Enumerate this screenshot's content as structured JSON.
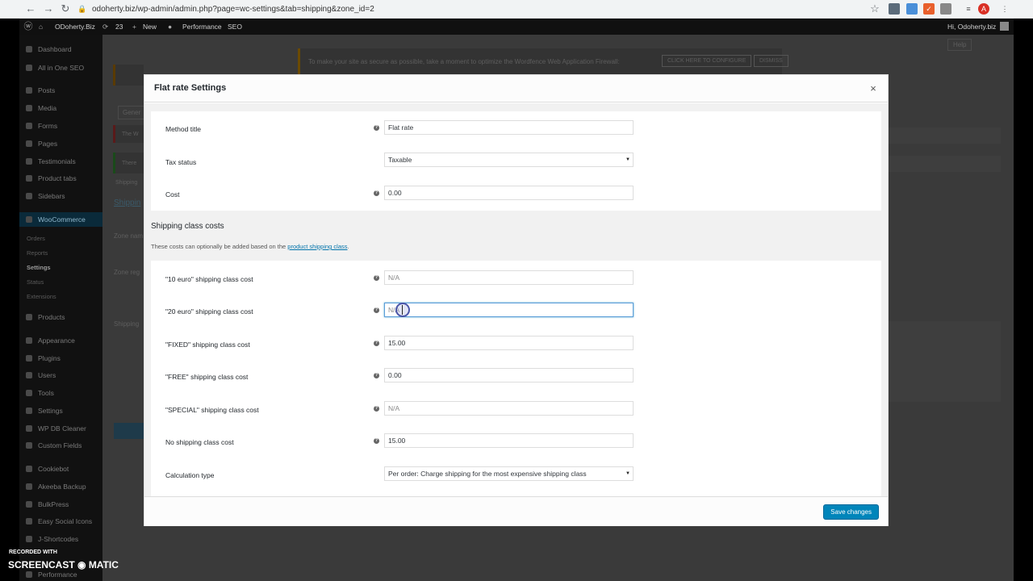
{
  "browser": {
    "url": "odoherty.biz/wp-admin/admin.php?page=wc-settings&tab=shipping&zone_id=2",
    "profile_initial": "A"
  },
  "adminbar": {
    "site_name": "ODoherty.Biz",
    "updates_count": "23",
    "new_label": "New",
    "performance_label": "Performance",
    "seo_label": "SEO",
    "greeting": "Hi, Odoherty.biz"
  },
  "sidebar": {
    "items": [
      {
        "label": "Dashboard"
      },
      {
        "label": "All in One SEO"
      },
      {
        "label": "Posts"
      },
      {
        "label": "Media"
      },
      {
        "label": "Forms"
      },
      {
        "label": "Pages"
      },
      {
        "label": "Testimonials"
      },
      {
        "label": "Product tabs"
      },
      {
        "label": "Sidebars"
      },
      {
        "label": "WooCommerce"
      },
      {
        "label": "Orders"
      },
      {
        "label": "Reports"
      },
      {
        "label": "Settings"
      },
      {
        "label": "Status"
      },
      {
        "label": "Extensions"
      },
      {
        "label": "Products"
      },
      {
        "label": "Appearance"
      },
      {
        "label": "Plugins"
      },
      {
        "label": "Users"
      },
      {
        "label": "Tools"
      },
      {
        "label": "Settings"
      },
      {
        "label": "WP DB Cleaner"
      },
      {
        "label": "Custom Fields"
      },
      {
        "label": "Cookiebot"
      },
      {
        "label": "Akeeba Backup"
      },
      {
        "label": "BulkPress"
      },
      {
        "label": "Easy Social Icons"
      },
      {
        "label": "J-Shortcodes"
      },
      {
        "label": "Performance"
      }
    ]
  },
  "background": {
    "notice_text": "To make your site as secure as possible, take a moment to optimize the Wordfence Web Application Firewall:",
    "notice_btn1": "CLICK HERE TO CONFIGURE",
    "notice_btn2": "DISMISS",
    "help_tab": "Help",
    "gen_tab": "Gener",
    "zone_name_label": "Zone nam",
    "zone_region_label": "Zone reg",
    "shipping_label": "Shipping",
    "shipping_link": "Shippin",
    "small_1": "The W",
    "small_2": "There",
    "small_3": "Shipping"
  },
  "modal": {
    "title": "Flat rate Settings",
    "close_glyph": "×",
    "help_glyph": "?",
    "fields": {
      "method_title": {
        "label": "Method title",
        "value": "Flat rate"
      },
      "tax_status": {
        "label": "Tax status",
        "value": "Taxable"
      },
      "cost": {
        "label": "Cost",
        "value": "0.00"
      }
    },
    "section_title": "Shipping class costs",
    "section_desc": "These costs can optionally be added based on the",
    "section_link": "product shipping class",
    "section_desc_end": ".",
    "class_costs": [
      {
        "label": "\"10 euro\" shipping class cost",
        "value": "",
        "placeholder": "N/A"
      },
      {
        "label": "\"20 euro\" shipping class cost",
        "value": "",
        "placeholder": "N/A"
      },
      {
        "label": "\"FIXED\" shipping class cost",
        "value": "15.00",
        "placeholder": "N/A"
      },
      {
        "label": "\"FREE\" shipping class cost",
        "value": "0.00",
        "placeholder": "N/A"
      },
      {
        "label": "\"SPECIAL\" shipping class cost",
        "value": "",
        "placeholder": "N/A"
      },
      {
        "label": "No shipping class cost",
        "value": "15.00",
        "placeholder": "N/A"
      }
    ],
    "calc_type": {
      "label": "Calculation type",
      "value": "Per order: Charge shipping for the most expensive shipping class"
    },
    "save_label": "Save changes"
  },
  "watermark": {
    "line1": "RECORDED WITH",
    "line2": "SCREENCAST ◉ MATIC"
  },
  "colors": {
    "accent": "#0085ba",
    "link": "#0073aa",
    "woocommerce_active": "#0a2a3a"
  }
}
